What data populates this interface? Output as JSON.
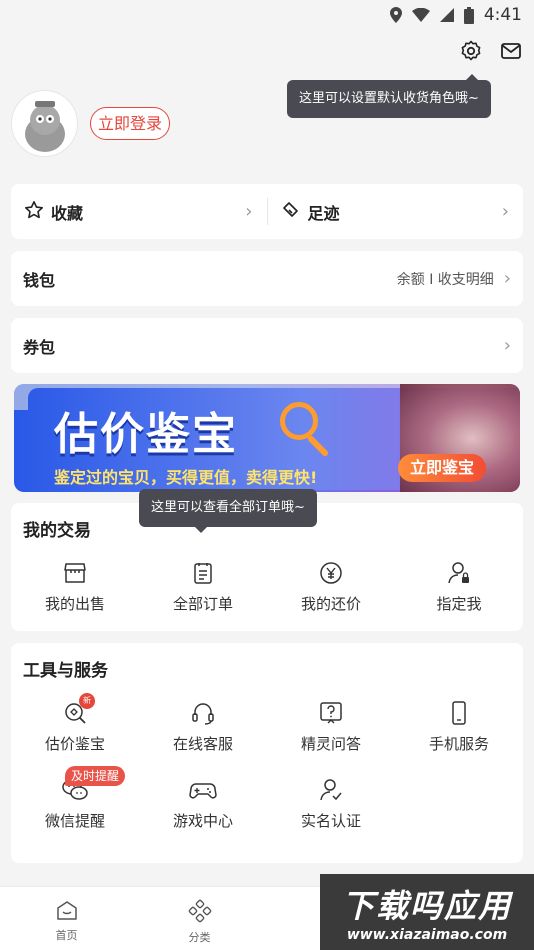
{
  "status_bar": {
    "time": "4:41"
  },
  "tooltips": {
    "settings": "这里可以设置默认收货角色哦~",
    "orders": "这里可以查看全部订单哦~"
  },
  "profile": {
    "login_label": "立即登录"
  },
  "quick": {
    "favorites": "收藏",
    "footprint": "足迹"
  },
  "wallet": {
    "title": "钱包",
    "detail": "余额 I 收支明细"
  },
  "coupon": {
    "title": "券包"
  },
  "banner": {
    "title": "估价鉴宝",
    "subtitle": "鉴定过的宝贝，买得更值，卖得更快!",
    "cta": "立即鉴宝"
  },
  "trade": {
    "title": "我的交易",
    "items": [
      {
        "label": "我的出售",
        "icon": "store-icon"
      },
      {
        "label": "全部订单",
        "icon": "order-list-icon"
      },
      {
        "label": "我的还价",
        "icon": "yen-coin-icon"
      },
      {
        "label": "指定我",
        "icon": "user-lock-icon"
      }
    ]
  },
  "tools": {
    "title": "工具与服务",
    "items": [
      {
        "label": "估价鉴宝",
        "icon": "appraise-icon",
        "badge": "新"
      },
      {
        "label": "在线客服",
        "icon": "headset-icon"
      },
      {
        "label": "精灵问答",
        "icon": "question-icon"
      },
      {
        "label": "手机服务",
        "icon": "phone-icon"
      },
      {
        "label": "微信提醒",
        "icon": "wechat-icon",
        "tag": "及时提醒"
      },
      {
        "label": "游戏中心",
        "icon": "gamepad-icon"
      },
      {
        "label": "实名认证",
        "icon": "verify-user-icon"
      }
    ]
  },
  "tabbar": {
    "items": [
      {
        "label": "首页",
        "icon": "home-icon"
      },
      {
        "label": "分类",
        "icon": "category-icon"
      }
    ]
  },
  "watermark": {
    "text": "下载吗应用",
    "url": "www.xiazaimao.com"
  }
}
